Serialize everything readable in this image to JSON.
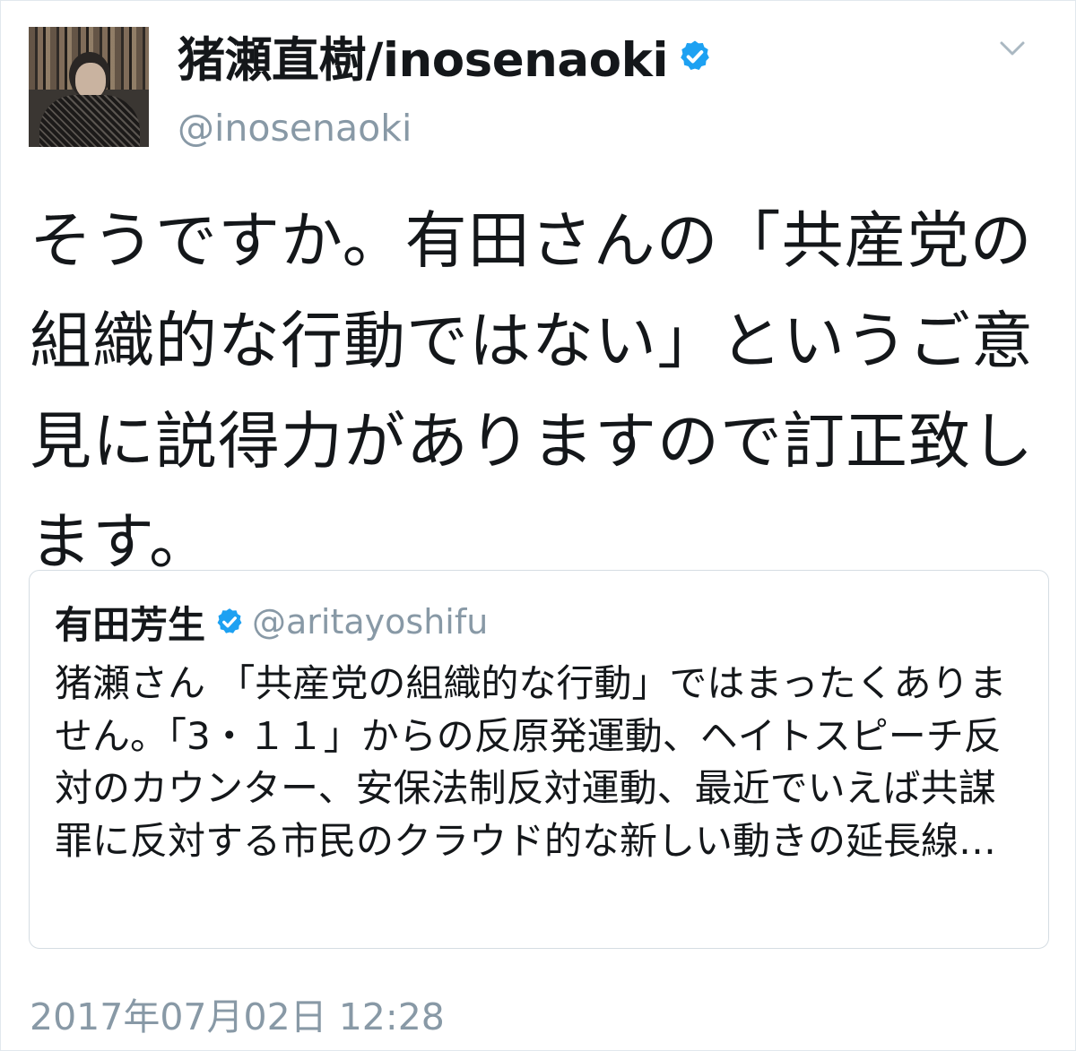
{
  "tweet": {
    "display_name": "猪瀬直樹/inosenaoki",
    "handle": "@inosenaoki",
    "text": "そうですか。有田さんの「共産党の組織的な行動ではない」というご意見に説得力がありますので訂正致します。",
    "timestamp": "2017年07月02日 12:28"
  },
  "quoted": {
    "display_name": "有田芳生",
    "handle": "@aritayoshifu",
    "text": "猪瀬さん 「共産党の組織的な行動」ではまったくありません。「3・１１」からの反原発運動、ヘイトスピーチ反対のカウンター、安保法制反対運動、最近でいえば共謀罪に反対する市民のクラウド的な新しい動きの延長線…"
  },
  "icons": {
    "verified": "verified-badge-icon",
    "menu": "chevron-down-icon"
  },
  "colors": {
    "verified_blue": "#1da1f2",
    "secondary_text": "#8899a6",
    "primary_text": "#14171a",
    "border": "#e1e8ed"
  }
}
